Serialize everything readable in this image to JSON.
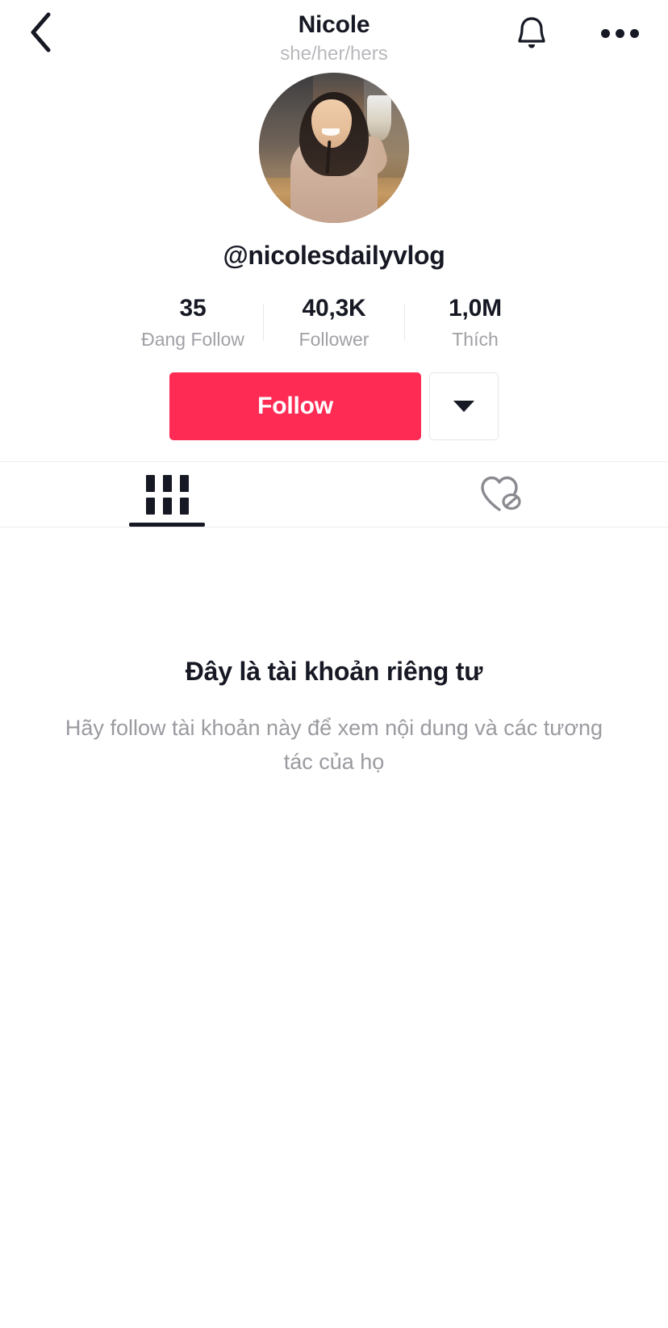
{
  "header": {
    "back_icon": "chevron-left-icon",
    "title": "Nicole",
    "pronouns": "she/her/hers",
    "bell_icon": "bell-icon",
    "more_icon": "more-horizontal-icon"
  },
  "profile": {
    "avatar_alt": "profile-photo",
    "username": "@nicolesdailyvlog"
  },
  "stats": [
    {
      "value": "35",
      "label": "Đang Follow"
    },
    {
      "value": "40,3K",
      "label": "Follower"
    },
    {
      "value": "1,0M",
      "label": "Thích"
    }
  ],
  "actions": {
    "follow_label": "Follow",
    "dropdown_icon": "caret-down-icon"
  },
  "tabs": [
    {
      "name": "videos",
      "icon": "grid-icon",
      "active": true
    },
    {
      "name": "liked",
      "icon": "heart-hidden-icon",
      "active": false
    }
  ],
  "private": {
    "title": "Đây là tài khoản riêng tư",
    "description": "Hãy follow tài khoản này để xem nội dung và các tương tác của họ"
  },
  "colors": {
    "accent": "#FE2C55",
    "text_primary": "#161823",
    "text_muted": "#A0A0A6",
    "divider": "#EDEDEF",
    "background": "#FFFFFF"
  }
}
